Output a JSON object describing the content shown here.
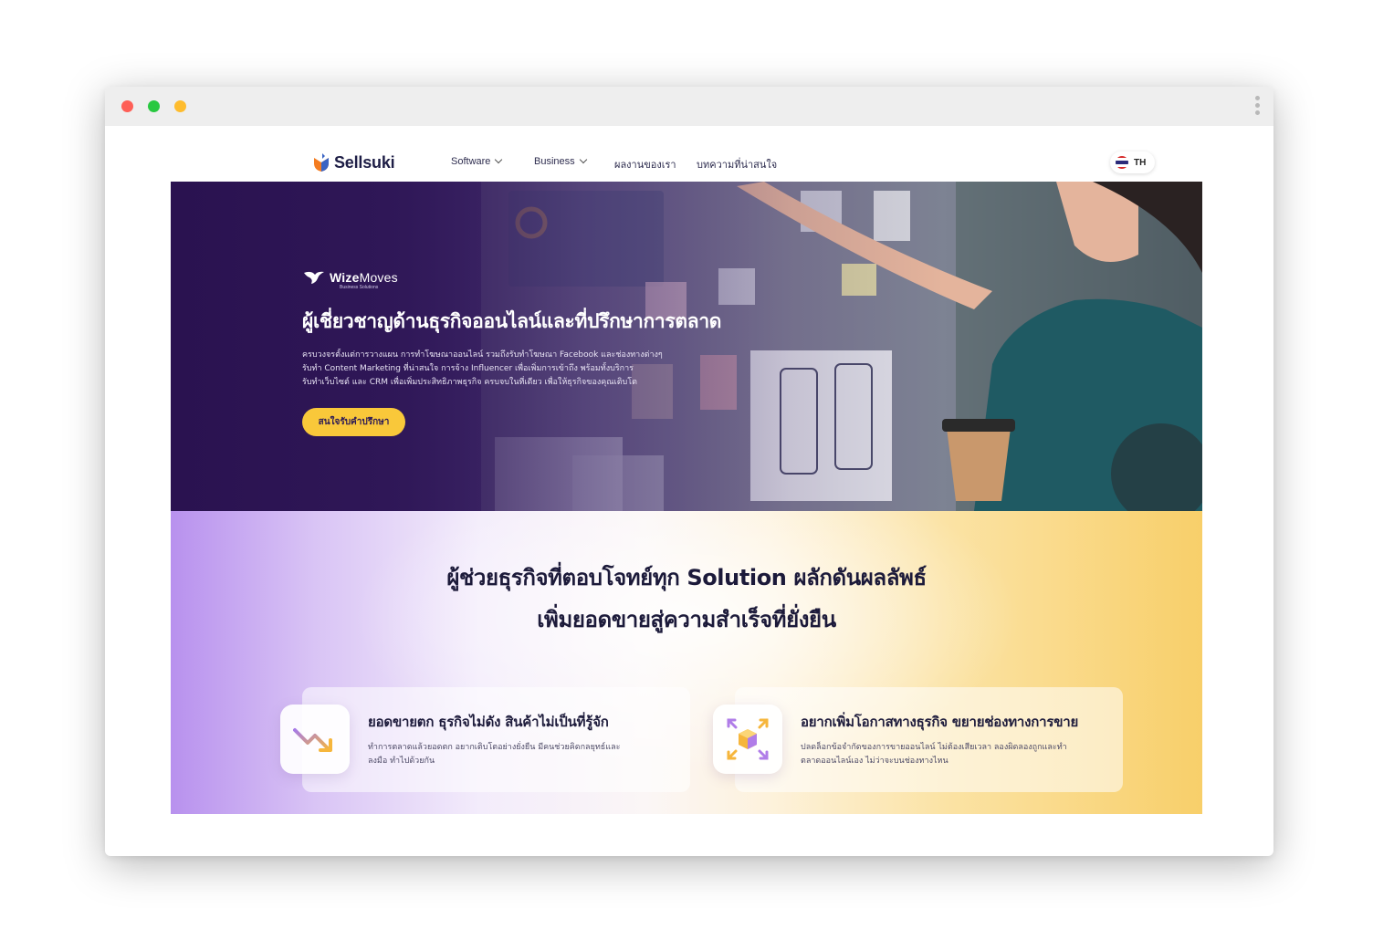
{
  "window": {
    "controls": [
      "close",
      "minimize",
      "maximize"
    ],
    "menu_icon": "kebab-menu-icon"
  },
  "header": {
    "logo_text": "Sellsuki",
    "nav": [
      {
        "label": "Software",
        "has_dropdown": true
      },
      {
        "label": "Business",
        "has_dropdown": true
      },
      {
        "label": "ผลงานของเรา",
        "has_dropdown": false
      },
      {
        "label": "บทความที่น่าสนใจ",
        "has_dropdown": false
      }
    ],
    "language": "TH"
  },
  "hero": {
    "brand_name_bold": "Wize",
    "brand_name_light": "Moves",
    "brand_sub": "Business Solutions",
    "title": "ผู้เชี่ยวชาญด้านธุรกิจออนไลน์และที่ปรึกษาการตลาด",
    "description_lines": [
      "ครบวงจรตั้งแต่การวางแผน การทำโฆษณาออนไลน์ รวมถึงรับทำโฆษณา Facebook และช่องทางต่างๆ",
      "รับทำ Content Marketing ที่น่าสนใจ การจ้าง Influencer เพื่อเพิ่มการเข้าถึง พร้อมทั้งบริการ",
      "รับทำเว็บไซต์ และ CRM เพื่อเพิ่มประสิทธิภาพธุรกิจ ครบจบในที่เดียว เพื่อให้ธุรกิจของคุณเติบโต"
    ],
    "cta": "สนใจรับคำปรึกษา"
  },
  "solutions": {
    "title_line1": "ผู้ช่วยธุรกิจที่ตอบโจทย์ทุก Solution ผลักดันผลลัพธ์",
    "title_line2": "เพิ่มยอดขายสู่ความสำเร็จที่ยั่งยืน",
    "cards": [
      {
        "icon": "trending-down-icon",
        "title": "ยอดขายตก ธุรกิจไม่ดัง สินค้าไม่เป็นที่รู้จัก",
        "desc_lines": [
          "ทำการตลาดแล้วยอดตก อยากเติบโตอย่างยั่งยืน มีคนช่วยคิดกลยุทธ์และ",
          "ลงมือ ทำไปด้วยกัน"
        ]
      },
      {
        "icon": "expand-box-icon",
        "title": "อยากเพิ่มโอกาสทางธุรกิจ ขยายช่องทางการขาย",
        "desc_lines": [
          "ปลดล็อกข้อจำกัดของการขายออนไลน์ ไม่ต้องเสียเวลา ลองผิดลองถูกและทำ",
          "ตลาดออนไลน์เอง ไม่ว่าจะบนช่องทางไหน"
        ]
      }
    ]
  },
  "colors": {
    "accent_yellow": "#f9c83a",
    "hero_purple": "#2c1552",
    "brand_orange": "#f47c20",
    "brand_navy": "#1e1e46"
  }
}
